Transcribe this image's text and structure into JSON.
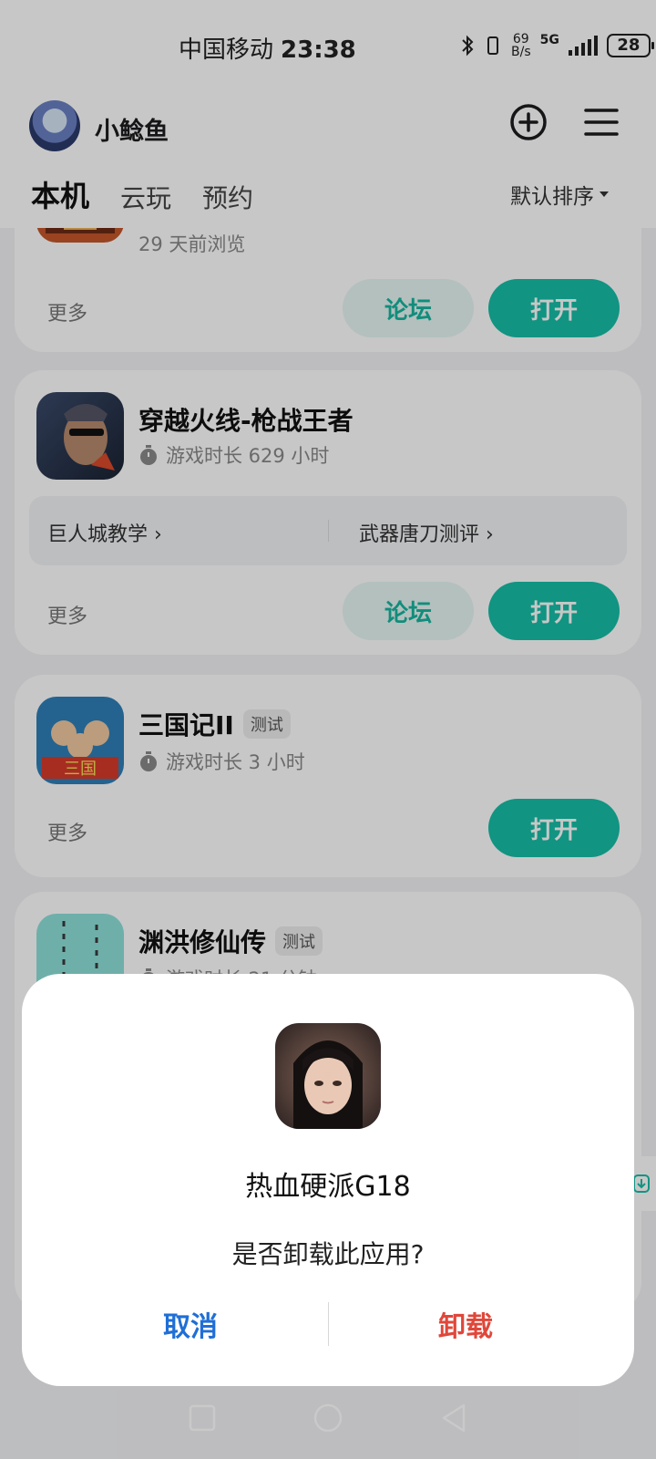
{
  "status_bar": {
    "carrier": "中国移动",
    "time": "23:38",
    "net_speed_value": "69",
    "net_speed_unit": "B/s",
    "network": "5G",
    "battery": "28"
  },
  "header": {
    "username": "小鲶鱼",
    "tabs": [
      {
        "label": "本机",
        "active": true
      },
      {
        "label": "云玩",
        "active": false
      },
      {
        "label": "预约",
        "active": false
      }
    ],
    "sort_label": "默认排序",
    "icons": [
      "add-icon",
      "menu-icon"
    ]
  },
  "games": [
    {
      "meta": "29 天前浏览",
      "more_label": "更多",
      "forum_label": "论坛",
      "open_label": "打开"
    },
    {
      "title": "穿越火线-枪战王者",
      "meta": "游戏时长 629 小时",
      "guides": [
        {
          "label": "巨人城教学"
        },
        {
          "label": "武器唐刀测评"
        }
      ],
      "more_label": "更多",
      "forum_label": "论坛",
      "open_label": "打开"
    },
    {
      "title": "三国记II",
      "badge": "测试",
      "meta": "游戏时长 3 小时",
      "more_label": "更多",
      "open_label": "打开"
    },
    {
      "title": "渊洪修仙传",
      "badge": "测试",
      "meta": "游戏时长 21 分钟"
    }
  ],
  "dialog": {
    "app_name": "热血硬派G18",
    "message": "是否卸载此应用?",
    "cancel_label": "取消",
    "confirm_label": "卸载",
    "colors": {
      "cancel": "#1f6fd6",
      "confirm": "#e0473a"
    }
  },
  "colors": {
    "accent": "#17bea7",
    "accent_light": "#e6f7f4"
  }
}
